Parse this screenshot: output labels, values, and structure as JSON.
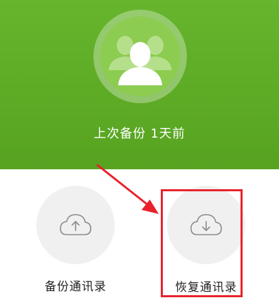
{
  "header": {
    "status_text": "上次备份 1天前",
    "avatar_icon": "contacts-group-icon",
    "background_color": "#5fad26"
  },
  "actions": {
    "backup": {
      "label": "备份通讯录",
      "icon": "cloud-upload-icon"
    },
    "restore": {
      "label": "恢复通讯录",
      "icon": "cloud-download-icon"
    }
  },
  "annotation": {
    "highlight_color": "#e8212b",
    "highlighted_item": "restore"
  }
}
